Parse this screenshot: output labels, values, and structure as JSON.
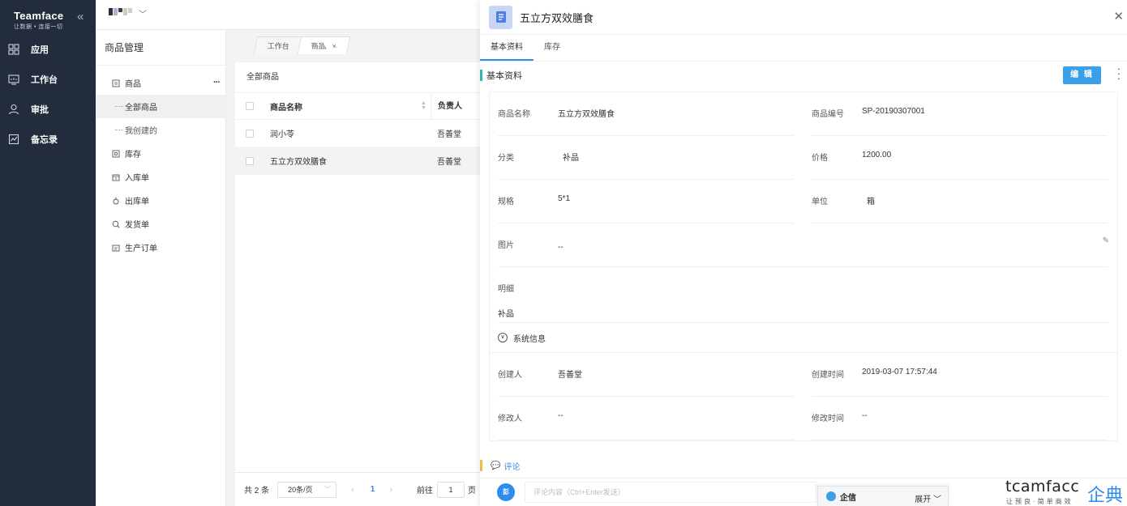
{
  "brand": {
    "name": "Teamface",
    "slogan": "让数据 • 连接一切"
  },
  "nav": {
    "items": [
      {
        "label": "应用",
        "icon": "apps-icon"
      },
      {
        "label": "工作台",
        "icon": "workbench-icon"
      },
      {
        "label": "审批",
        "icon": "approval-icon"
      },
      {
        "label": "备忘录",
        "icon": "memo-icon"
      }
    ]
  },
  "tree": {
    "title": "商品管理",
    "nodes": [
      {
        "label": "商品",
        "icon": "product-icon"
      },
      {
        "label": "全部商品"
      },
      {
        "label": "我创建的"
      },
      {
        "label": "库存",
        "icon": "inventory-icon"
      },
      {
        "label": "入库单",
        "icon": "inbound-icon"
      },
      {
        "label": "出库单",
        "icon": "outbound-icon"
      },
      {
        "label": "发货单",
        "icon": "shipment-icon"
      },
      {
        "label": "生产订单",
        "icon": "production-order-icon"
      }
    ]
  },
  "tabs": [
    {
      "label": "工作台"
    },
    {
      "label": "商品",
      "close": "×"
    }
  ],
  "list": {
    "header": "全部商品",
    "columns": [
      "商品名称",
      "负责人"
    ],
    "rows": [
      [
        "润小苓",
        "吾善堂"
      ],
      [
        "五立方双效膳食",
        "吾善堂"
      ]
    ],
    "pager": {
      "total": "共 2 条",
      "page_size": "20条/页",
      "current": "1",
      "goto_label": "前往",
      "goto_value": "1",
      "page_suffix": "页"
    }
  },
  "drawer": {
    "title": "五立方双效膳食",
    "tabs": [
      "基本资料",
      "库存"
    ],
    "section_title": "基本资料",
    "edit_label": "编 辑",
    "fields": [
      {
        "label": "商品名称",
        "value": "五立方双效膳食"
      },
      {
        "label": "商品编号",
        "value": "SP-20190307001"
      },
      {
        "label": "分类",
        "value": "补品"
      },
      {
        "label": "价格",
        "value": "1200.00"
      },
      {
        "label": "规格",
        "value": "5*1"
      },
      {
        "label": "单位",
        "value": "箱"
      },
      {
        "label": "图片",
        "value": "--"
      }
    ],
    "detail_label": "明细",
    "detail_value": "补品",
    "system_info_label": "系统信息",
    "system_fields": [
      {
        "label": "创建人",
        "value": "吾善堂"
      },
      {
        "label": "创建时间",
        "value": "2019-03-07 17:57:44"
      },
      {
        "label": "修改人",
        "value": "--"
      },
      {
        "label": "修改时间",
        "value": "--"
      }
    ],
    "comment_label": "评论",
    "comment_avatar": "彭",
    "comment_placeholder": "评论内容（Ctrl+Enter发送）"
  },
  "chat": {
    "label": "企信",
    "expand": "展开"
  },
  "watermark": {
    "en": "tcamfacc",
    "zh": "企典",
    "sub": "让预良·简单商效"
  },
  "colors": {
    "sidebar": "#222c3c",
    "accent": "#2d8cf0",
    "edit_button": "#3aa0e8",
    "section_mark": "#2fb6b1",
    "comment_mark": "#f0b94a"
  }
}
